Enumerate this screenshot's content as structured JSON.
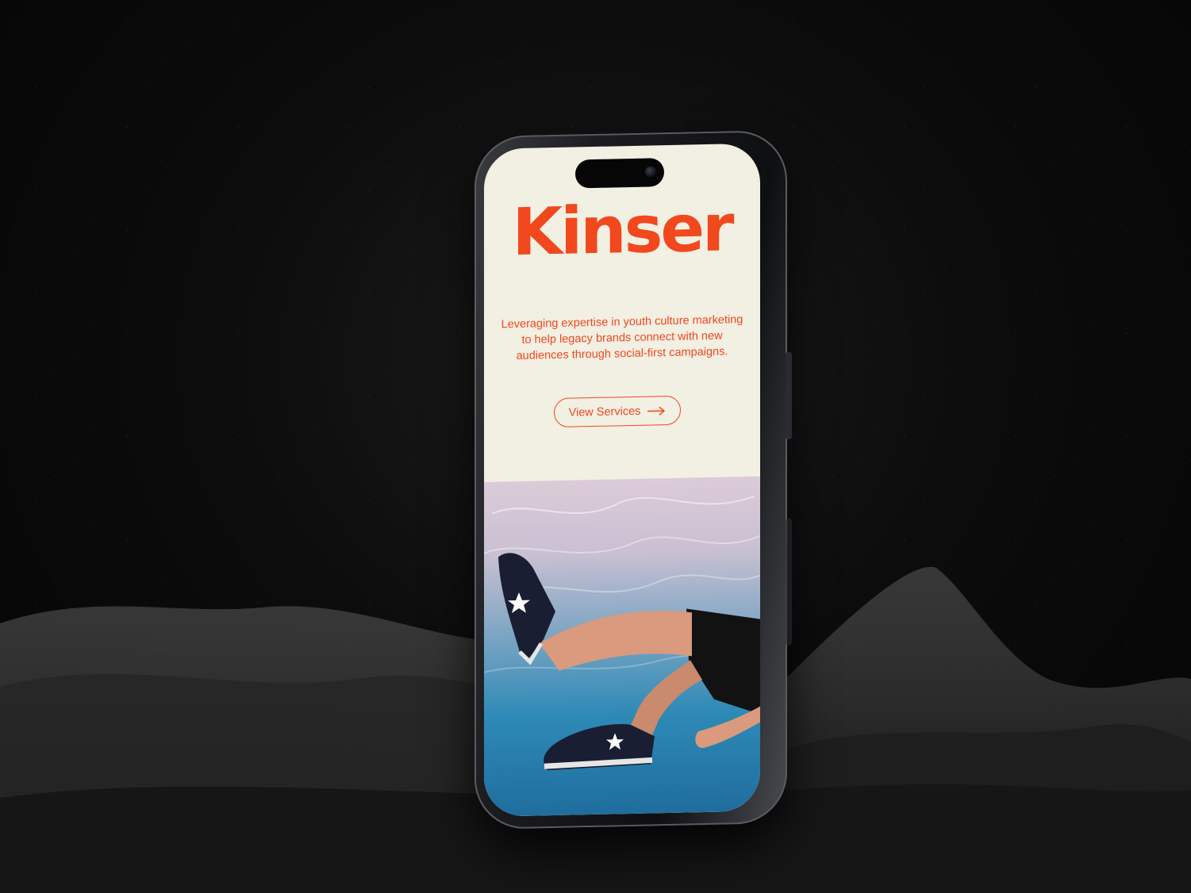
{
  "app": {
    "brand": "Kinser",
    "tagline": "Leveraging expertise in youth culture marketing to help legacy brands connect with new audiences through social-first campaigns.",
    "cta_label": "View Services"
  },
  "colors": {
    "accent": "#f1481d",
    "screen_bg": "#f2efe3",
    "backdrop": "#070707"
  },
  "icons": {
    "cta_icon": "arrow-right-icon"
  },
  "hero_image": {
    "subject": "underwater legs in star sneakers"
  }
}
